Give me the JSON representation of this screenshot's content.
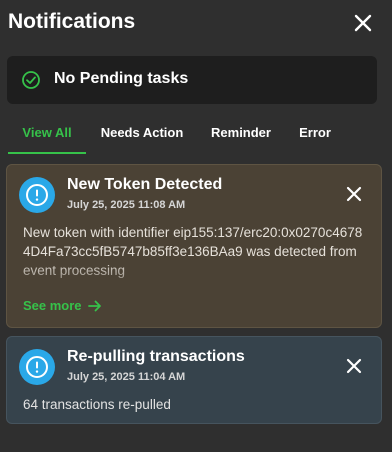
{
  "header": {
    "title": "Notifications"
  },
  "pending": {
    "label": "No Pending tasks"
  },
  "tabs": [
    {
      "label": "View All",
      "active": true
    },
    {
      "label": "Needs Action",
      "active": false
    },
    {
      "label": "Reminder",
      "active": false
    },
    {
      "label": "Error",
      "active": false
    }
  ],
  "notifications": [
    {
      "title": "New Token Detected",
      "time": "July 25, 2025 11:08 AM",
      "body": "New token with identifier eip155:137/erc20:0x0270c46784D4Fa73cc5fB5747b85ff3e136BAa9 was detected from event processing",
      "see_more": "See more",
      "icon": "info-icon"
    },
    {
      "title": "Re-pulling transactions",
      "time": "July 25, 2025 11:04 AM",
      "body": "64 transactions re-pulled",
      "icon": "info-icon"
    }
  ],
  "colors": {
    "background": "#2f2f2f",
    "accent": "#36c24a",
    "info_blue": "#2aa8e8",
    "token_card": "#4b4235",
    "repull_card": "#36434c"
  }
}
